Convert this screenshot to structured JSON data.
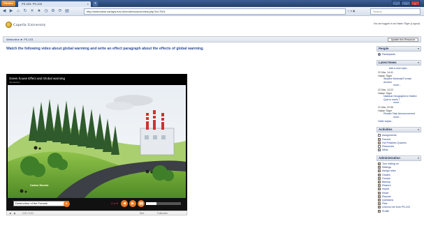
{
  "browser": {
    "app_button": "Firefox",
    "tab_title": "PS-203: PS-103",
    "tab_close": "×",
    "new_tab": "+",
    "window_controls": [
      "–",
      "□",
      "×"
    ],
    "nav_icons": [
      "back-icon",
      "forward-icon",
      "home-icon",
      "reload-icon",
      "stop-icon",
      "bookmark-icon",
      "history-icon",
      "tools-icon",
      "refresh-icon",
      "page-icon"
    ],
    "url": "http://webonline.carlaya.edu.nl/mod/resource/view.php?id=7001",
    "search_placeholder": "Search"
  },
  "site": {
    "logo_text": "Capella University",
    "login_info": "You are logged in as Haken Tilger (Logout)",
    "breadcrumb": "Webonline ► PS-103",
    "update_button": "Update this Resource"
  },
  "main": {
    "instruction": "Watch the following video about global warming and write an effect paragraph about the effects of global warming."
  },
  "video": {
    "title": "Green house Effect and Global warming",
    "subtitle": "Introduction",
    "carbon_label": "Carbon Dioxide",
    "chapter": "Destruction of the Forests",
    "page_count": "4 of 8",
    "controls": [
      "◀",
      "▶",
      "▮▮"
    ],
    "volume_level": 0.3,
    "player_bar": [
      "◀",
      "▶",
      "0:00 / 0:00",
      "Size",
      "Fullscreen"
    ]
  },
  "sidebar": {
    "people": {
      "title": "People",
      "items": [
        "Participants"
      ]
    },
    "latest_news": {
      "title": "Latest News",
      "add_topic": "Add a new topic...",
      "items": [
        {
          "date": "22 Mar, 14:41",
          "author": "Hakan Tilger",
          "title": "Student Webmail Format Acction",
          "more": "more..."
        },
        {
          "date": "22 Mar, 13:22",
          "author": "Hakan Tilger",
          "title": "National Geographic's Hidden Quiz in week 7",
          "more": "more..."
        },
        {
          "date": "21 Mar, 22:56",
          "author": "Hakan Tilger",
          "title": "Reader Task Announcement",
          "more": "more..."
        }
      ],
      "older": "Older topics..."
    },
    "activities": {
      "title": "Activities",
      "items": [
        "Assignments",
        "Forums",
        "Hot Potatoes Quizzes",
        "Resources",
        "Wikis"
      ]
    },
    "administration": {
      "title": "Administration",
      "items": [
        "Turn editing on",
        "Settings",
        "Assign roles",
        "Grades",
        "Groups",
        "Backup",
        "Restore",
        "Import",
        "Reset",
        "Reports",
        "Questions",
        "Files",
        "Unenrol me from PS-103",
        "Profile"
      ]
    }
  }
}
